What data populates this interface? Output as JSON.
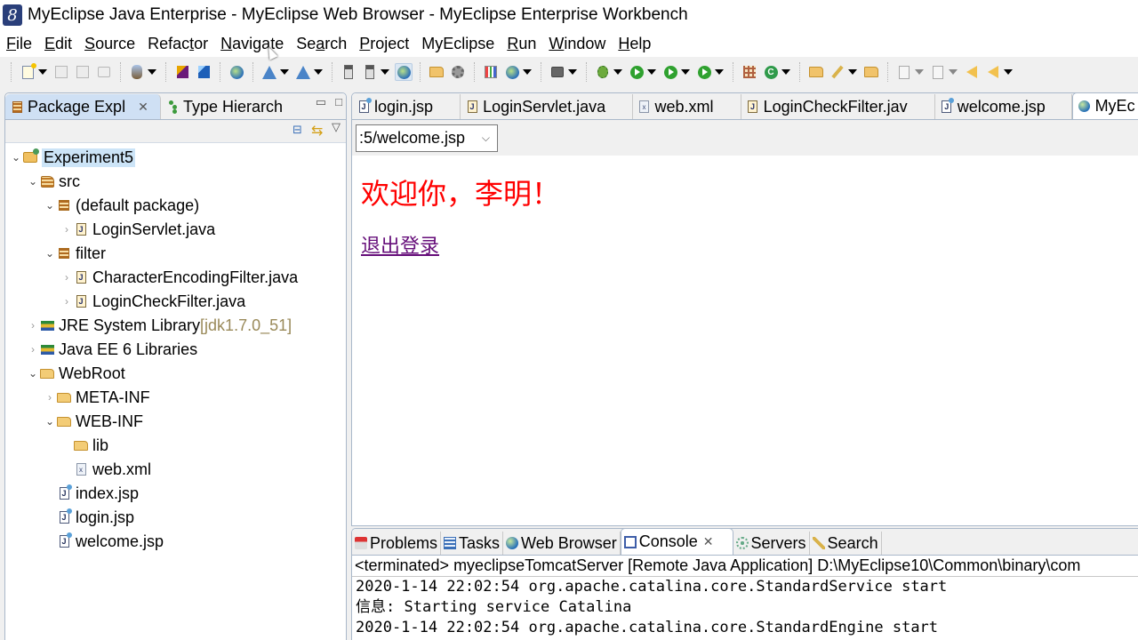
{
  "window": {
    "title": "MyEclipse Java Enterprise - MyEclipse Web Browser - MyEclipse Enterprise Workbench",
    "logo_glyph": "8"
  },
  "menubar": {
    "items": [
      {
        "label": "File",
        "mnemonic": "F",
        "rest": "ile"
      },
      {
        "label": "Edit",
        "mnemonic": "E",
        "rest": "dit"
      },
      {
        "label": "Source",
        "mnemonic": "S",
        "rest": "ource"
      },
      {
        "label": "Refactor",
        "pre": "Refac",
        "mnemonic": "t",
        "rest": "or"
      },
      {
        "label": "Navigate",
        "mnemonic": "N",
        "rest": "avigate"
      },
      {
        "label": "Search",
        "pre": "Se",
        "mnemonic": "a",
        "rest": "rch"
      },
      {
        "label": "Project",
        "mnemonic": "P",
        "rest": "roject"
      },
      {
        "label": "MyEclipse",
        "plain": "MyEclipse"
      },
      {
        "label": "Run",
        "mnemonic": "R",
        "rest": "un"
      },
      {
        "label": "Window",
        "mnemonic": "W",
        "rest": "indow"
      },
      {
        "label": "Help",
        "mnemonic": "H",
        "rest": "elp"
      }
    ]
  },
  "toolbar": {
    "buttons": [
      "new-file-icon",
      "save-icon",
      "save-all-icon",
      "print-icon",
      "new-bean-icon",
      "new-ejb-icon",
      "new-web-project-icon",
      "web-2-0-icon",
      "deploy-icon",
      "deploy-server-icon",
      "server-manage-icon",
      "server-run-icon",
      "web-browser-icon",
      "open-folder-icon",
      "remote-icon",
      "report-icon",
      "globe-search-icon",
      "camera-icon",
      "debug-icon",
      "run-icon",
      "run-history-icon",
      "external-tools-icon",
      "new-package-icon",
      "new-class-icon",
      "open-type-icon",
      "search-pen-icon",
      "open-resource-icon",
      "next-annotation-icon",
      "prev-annotation-icon",
      "last-edit-icon",
      "back-icon"
    ]
  },
  "left_panel": {
    "tabs": [
      {
        "label": "Package Expl",
        "active": true,
        "closable": true
      },
      {
        "label": "Type Hierarch",
        "active": false
      }
    ],
    "tree": [
      {
        "label": "Experiment5",
        "level": 0,
        "state": "expanded",
        "icon": "project-icon",
        "selected": true
      },
      {
        "label": "src",
        "level": 1,
        "state": "expanded",
        "icon": "source-folder-icon"
      },
      {
        "label": "(default package)",
        "level": 2,
        "state": "expanded",
        "icon": "package-icon"
      },
      {
        "label": "LoginServlet.java",
        "level": 3,
        "state": "collapsed",
        "icon": "java-file-icon"
      },
      {
        "label": "filter",
        "level": 2,
        "state": "expanded",
        "icon": "package-icon"
      },
      {
        "label": "CharacterEncodingFilter.java",
        "level": 3,
        "state": "collapsed",
        "icon": "java-file-icon"
      },
      {
        "label": "LoginCheckFilter.java",
        "level": 3,
        "state": "collapsed",
        "icon": "java-file-icon"
      },
      {
        "label": "JRE System Library",
        "suffix": "[jdk1.7.0_51]",
        "level": 1,
        "state": "collapsed",
        "icon": "library-icon"
      },
      {
        "label": "Java EE 6 Libraries",
        "level": 1,
        "state": "collapsed",
        "icon": "library-icon"
      },
      {
        "label": "WebRoot",
        "level": 1,
        "state": "expanded",
        "icon": "folder-icon"
      },
      {
        "label": "META-INF",
        "level": 2,
        "state": "collapsed",
        "icon": "folder-icon"
      },
      {
        "label": "WEB-INF",
        "level": 2,
        "state": "expanded",
        "icon": "folder-icon"
      },
      {
        "label": "lib",
        "level": 3,
        "state": "leaf",
        "icon": "folder-icon"
      },
      {
        "label": "web.xml",
        "level": 3,
        "state": "leaf",
        "icon": "xml-file-icon"
      },
      {
        "label": "index.jsp",
        "level": 2,
        "state": "leaf",
        "icon": "jsp-file-icon"
      },
      {
        "label": "login.jsp",
        "level": 2,
        "state": "leaf",
        "icon": "jsp-file-icon"
      },
      {
        "label": "welcome.jsp",
        "level": 2,
        "state": "leaf",
        "icon": "jsp-file-icon"
      }
    ]
  },
  "editor": {
    "tabs": [
      {
        "label": "login.jsp",
        "icon": "jsp"
      },
      {
        "label": "LoginServlet.java",
        "icon": "java"
      },
      {
        "label": "web.xml",
        "icon": "xml"
      },
      {
        "label": "LoginCheckFilter.jav",
        "icon": "java"
      },
      {
        "label": "welcome.jsp",
        "icon": "jsp"
      },
      {
        "label": "MyEc",
        "icon": "globe",
        "active": true
      }
    ],
    "browser": {
      "url_value": ":5/welcome.jsp",
      "welcome_text": "欢迎你，李明！",
      "logout_link": "退出登录",
      "welcome_color": "#ff0000",
      "link_color": "#660e7a"
    }
  },
  "bottom_panel": {
    "tabs": [
      {
        "label": "Problems",
        "icon": "problems"
      },
      {
        "label": "Tasks",
        "icon": "tasks"
      },
      {
        "label": "Web Browser",
        "icon": "globe"
      },
      {
        "label": "Console",
        "icon": "console",
        "active": true,
        "closable": true
      },
      {
        "label": "Servers",
        "icon": "servers"
      },
      {
        "label": "Search",
        "icon": "search"
      }
    ],
    "console_header": "<terminated> myeclipseTomcatServer [Remote Java Application] D:\\MyEclipse10\\Common\\binary\\com",
    "console_lines": [
      "2020-1-14 22:02:54 org.apache.catalina.core.StandardService start",
      "信息: Starting service Catalina",
      "2020-1-14 22:02:54 org.apache.catalina.core.StandardEngine start"
    ]
  }
}
